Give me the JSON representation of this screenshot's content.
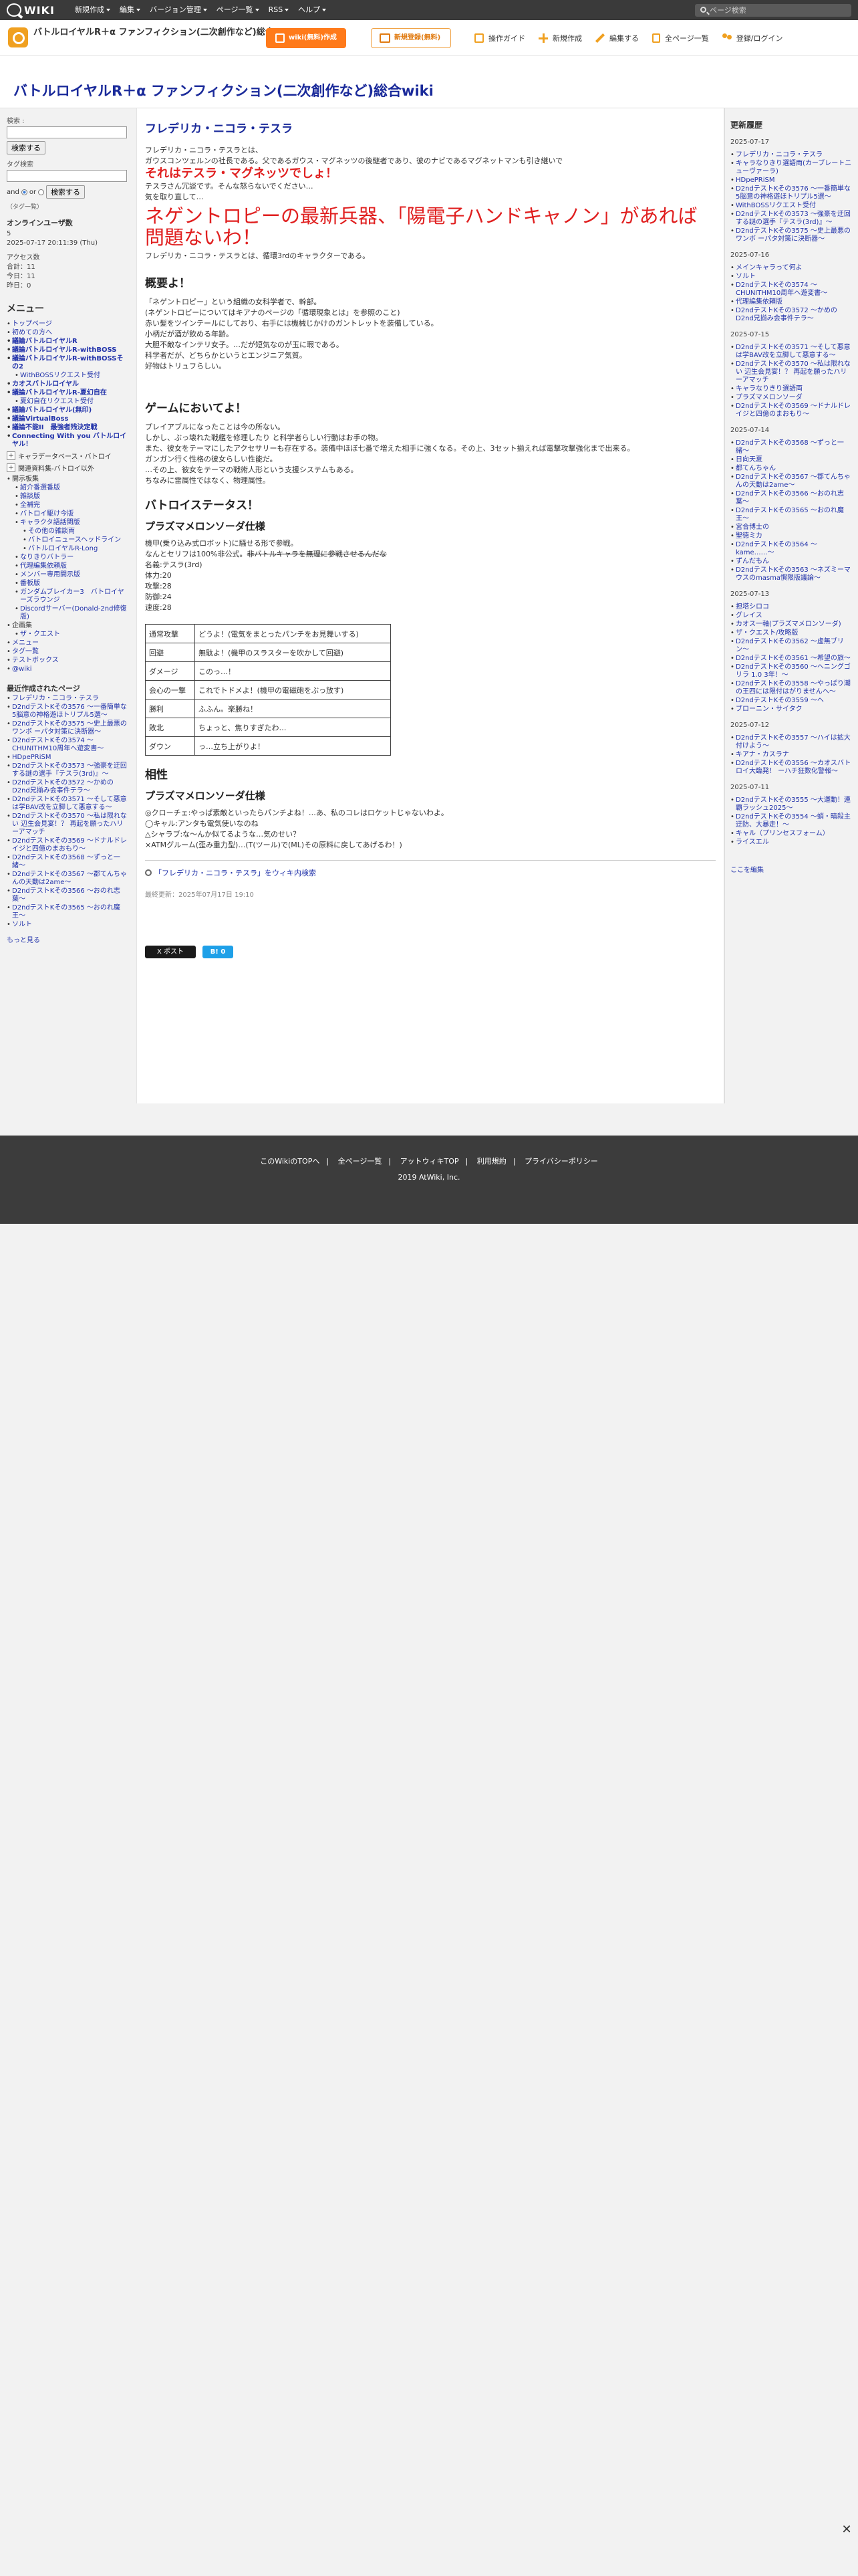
{
  "topbar": {
    "logo_text": "WIKI",
    "menu": [
      "新規作成",
      "編集",
      "バージョン管理",
      "ページ一覧",
      "RSS",
      "ヘルプ"
    ],
    "search_placeholder": "ページ検索"
  },
  "header": {
    "wiki_title": "バトルロイヤルR＋α ファンフィクション(二次創作など)総合wiki",
    "btn_create": "wiki(無料)作成",
    "btn_member": "新規登録(無料)",
    "nav": [
      "操作ガイド",
      "新規作成",
      "編集する",
      "全ページ一覧",
      "登録/ログイン"
    ]
  },
  "page_heading": "バトルロイヤルR＋α ファンフィクション(二次創作など)総合wiki",
  "left": {
    "search_label": "検索 :",
    "search_button": "検索する",
    "tag_label": "タグ検索",
    "tag_button": "検索する",
    "and_label": "and",
    "or_label": "or",
    "tag_cloud": "（タグ一覧）",
    "online_title": "オンラインユーザ数",
    "online_count": "5",
    "online_time": "2025-07-17 20:11:39 (Thu)",
    "access_title": "アクセス数",
    "access_total": "合計：11",
    "access_today": "今日：11",
    "access_yesterday": "昨日：0",
    "menu_title": "メニュー",
    "menu_items": [
      {
        "t": "トップページ",
        "c": ""
      },
      {
        "t": "初めての方へ",
        "c": ""
      },
      {
        "t": "議論バトルロイヤルR",
        "c": "b"
      },
      {
        "t": "議論バトルロイヤルR-withBOSS",
        "c": "b"
      },
      {
        "t": "議論バトルロイヤルR-withBOSSその2",
        "c": "b"
      },
      {
        "t": "WithBOSSリクエスト受付",
        "c": "s1"
      },
      {
        "t": "カオスバトルロイヤル",
        "c": "b"
      },
      {
        "t": "議論バトルロイヤルR-夏幻自在",
        "c": "b"
      },
      {
        "t": "夏幻自在リクエスト受付",
        "c": "s1"
      },
      {
        "t": "議論バトルロイヤル(無印)",
        "c": "b"
      },
      {
        "t": "議論VirtualBoss",
        "c": "b"
      },
      {
        "t": "議論不能II　最強者残決定戦",
        "c": "b"
      },
      {
        "t": "Connecting With you バトルロイヤル！",
        "c": "b"
      }
    ],
    "toggle1": "キャラデータベース・バトロイ",
    "toggle2": "関連資料集-バトロイ以外",
    "menu_items2": [
      {
        "t": "開示板集",
        "c": "plain"
      },
      {
        "t": "紹介番選番版",
        "c": "s1"
      },
      {
        "t": "雑談版",
        "c": "s1"
      },
      {
        "t": "全補完",
        "c": "s1"
      },
      {
        "t": "バトロイ駆け今版",
        "c": "s1"
      },
      {
        "t": "キャラクタ語話関版",
        "c": "s1"
      },
      {
        "t": "その他の雑談両",
        "c": "s2"
      },
      {
        "t": "バトロイニュースヘッドライン",
        "c": "s2"
      },
      {
        "t": "バトルロイヤルR-Long",
        "c": "s2"
      },
      {
        "t": "なりきりバトラー",
        "c": "s1"
      },
      {
        "t": "代理編集依頼版",
        "c": "s1"
      },
      {
        "t": "メンバー専用開示版",
        "c": "s1"
      },
      {
        "t": "番板版",
        "c": "s1"
      },
      {
        "t": "ガンダムブレイカー3　バトロイヤーズラウンジ",
        "c": "s1"
      },
      {
        "t": "Discordサーバー(Donald-2nd修復版)",
        "c": "s1"
      },
      {
        "t": "企画集",
        "c": "plain"
      },
      {
        "t": "ザ・クエスト",
        "c": "s1"
      },
      {
        "t": "メニュー",
        "c": ""
      },
      {
        "t": "タグ一覧",
        "c": ""
      },
      {
        "t": "テストボックス",
        "c": ""
      },
      {
        "t": "@wiki",
        "c": ""
      }
    ],
    "recent_title": "最近作成されたページ",
    "recent_items": [
      "フレデリカ・ニコラ・テスラ",
      "D2ndテストKその3576 〜一番簡単な5脳意の神格遊ほトリプル5選〜",
      "D2ndテストKその3575 〜史上最悪のワンボ ーパタ対策に決断器〜",
      "D2ndテストKその3574 〜CHUNITHM10周年へ遊変書〜",
      "HDpePRiSM",
      "D2ndテストKその3573 〜強豪を迂回する謎の選手『テスラ(3rd)』〜",
      "D2ndテストKその3572 〜かめのD2nd兄揃み会事件テラ〜",
      "D2ndテストKその3571 〜そして悪意は学BAV改を立脚して悪意する〜",
      "D2ndテストKその3570 〜私は限れない 辺生会見宴！？ 再起を願ったハリーアマッチ",
      "D2ndテストKその3569 〜ドナルドレイジと四億のまおもり〜",
      "D2ndテストKその3568 〜ずっと一緒〜",
      "D2ndテストKその3567 〜郡てんちゃんの天動は2ame〜",
      "D2ndテストKその3566 〜おのれ志葉〜",
      "D2ndテストKその3565 〜おのれ魔王〜",
      "ソルト"
    ],
    "more": "もっと見る"
  },
  "main": {
    "title": "フレデリカ・ニコラ・テスラ",
    "intro1": "フレデリカ・ニコラ・テスラとは、",
    "intro2": "ガウスコンツェルンの社長である。父であるガウス・マグネッツの後継者であり、彼のナビであるマグネットマンも引き継いで",
    "red1": "それはテスラ・マグネッツでしょ！",
    "intro3": "テスラさん冗談です。そんな怒らないでください…",
    "intro4": "気を取り直して…",
    "red2": "ネゲントロピーの最新兵器、「陽電子ハンドキャノン」があれば問題ないわ！",
    "intro5": "フレデリカ・ニコラ・テスラとは、循環3rdのキャラクターである。",
    "h_overview": "概要よ！",
    "overview": [
      "「ネゲントロピー」という組織の女科学者で、幹部。",
      "(ネゲントロピーについてはキアナのページの「循環現象とは」を参照のこと)",
      "赤い髪をツインテールにしており、右手には機械じかけのガントレットを装備している。",
      "小柄だが酒が飲める年齢。",
      "大胆不敵なインテリ女子。…だが短気なのが玉に瑕である。",
      "科学者だが、どちらかというとエンジニア気質。",
      "好物はトリュフらしい。"
    ],
    "h_game": "ゲームにおいてよ！",
    "game": [
      "プレイアブルになったことは今の所ない。",
      "しかし、ぶっ壊れた戦艦を修理したり と科学者らしい行動はお手の物。",
      "また、彼女をテーマにしたアクセサリーも存在する。装備中ほぼ七番で増えた相手に強くなる。その上、3セット揃えれば電撃攻撃強化まで出来る。",
      "ガンガン行く性格の彼女らしい性能だ。",
      "…その上、彼女をテーマの戦術人形という支援システムもある。",
      "ちなみに雷属性ではなく、物理属性。"
    ],
    "h_status": "バトロイステータス！",
    "h_prism": "プラズマメロンソーダ仕様",
    "status": [
      "機甲(乗り込み式ロボット)に騒せる形で参戦。",
      "なんとセリフは100%非公式。"
    ],
    "status_strike": "非バトルキャラを無理に参戦させるんだな",
    "stats": [
      "名義:テスラ(3rd)",
      "体力:20",
      "攻撃:28",
      "防御:24",
      "速度:28"
    ],
    "table": [
      {
        "k": "通常攻撃",
        "v": "どうよ！(電気をまとったパンチをお見舞いする)"
      },
      {
        "k": "回避",
        "v": "無駄よ！(機甲のスラスターを吹かして回避)"
      },
      {
        "k": "ダメージ",
        "v": "このっ…！"
      },
      {
        "k": "会心の一撃",
        "v": "これでトドメよ！(機甲の電磁砲をぶっ放す)"
      },
      {
        "k": "勝利",
        "v": "ふふん。楽勝ね！"
      },
      {
        "k": "敗北",
        "v": "ちょっと、焦りすぎたわ…"
      },
      {
        "k": "ダウン",
        "v": "っ…立ち上がりよ！"
      }
    ],
    "h_affinity": "相性",
    "h_prism2": "プラズマメロンソーダ仕様",
    "affinity": [
      "◎クローチェ:やっぱ素敵といったらパンチよね！…あ、私のコレはロケットじゃないわよ。",
      "◯キャル:アンタも電気使いなのね",
      "△シャラブ:な〜んか似てるような…気のせい？",
      "×ATMグルーム(歪み重力型)…(T(ツール)で(ML)その原料に戻してあげるわ！)"
    ],
    "related": "「フレデリカ・ニコラ・テスラ」をウィキ内検索",
    "updated": "最終更新：2025年07月17日 19:10",
    "post_button": "X ポスト",
    "hatena_button": "B! 0"
  },
  "right": {
    "title": "更新履歴",
    "groups": [
      {
        "date": "2025-07-17",
        "items": [
          "フレデリカ・ニコラ・テスラ",
          "キャラなりきり選語両(カーブレートニューヴァーラ)",
          "HDpePRiSM",
          "D2ndテストKその3576 〜一番簡単な5脳意の神格遊ほトリプル5選〜",
          "WithBOSSリクエスト受付",
          "D2ndテストKその3573 〜強豪を迂回する謎の選手『テスラ(3rd)』〜",
          "D2ndテストKその3575 〜史上最悪のワンボ ーパタ対策に決断器〜"
        ]
      },
      {
        "date": "2025-07-16",
        "items": [
          "メインキャラって何よ",
          "ソルト",
          "D2ndテストKその3574 〜CHUNITHM10周年へ遊変書〜",
          "代理編集依頼版",
          "D2ndテストKその3572 〜かめのD2nd兄揃み会事件テラ〜"
        ]
      },
      {
        "date": "2025-07-15",
        "items": [
          "D2ndテストKその3571 〜そして悪意は学BAV改を立脚して悪意する〜",
          "D2ndテストKその3570 〜私は限れない 辺生会見宴！？ 再起を願ったハリーアマッチ",
          "キャラなりきり選語両",
          "プラズマメロンソーダ",
          "D2ndテストKその3569 〜ドナルドレイジと四億のまおもり〜"
        ]
      },
      {
        "date": "2025-07-14",
        "items": [
          "D2ndテストKその3568 〜ずっと一緒〜",
          "日向天夏",
          "都てんちゃん",
          "D2ndテストKその3567 〜郡てんちゃんの天動は2ame〜",
          "D2ndテストKその3566 〜おのれ志葉〜",
          "D2ndテストKその3565 〜おのれ魔王〜",
          "宮合博士の",
          "聖徳ミカ",
          "D2ndテストKその3564 〜kame……〜",
          "ずんだもん",
          "D2ndテストKその3563 〜ネズミーマウスのmasma慣限版議論〜"
        ]
      },
      {
        "date": "2025-07-13",
        "items": [
          "担塔シロコ",
          "グレイス",
          "カオス一軸(プラズマメロンソーダ)",
          "ザ・クエスト/攻略版",
          "D2ndテストKその3562 〜虚無ブリン〜",
          "D2ndテストKその3561 〜希望の旅〜",
          "D2ndテストKその3560 〜ヘニングゴリラ 1.0 3年！〜",
          "D2ndテストKその3558 〜やっぱり潮の王四には限付はがりませんヘ〜",
          "D2ndテストKその3559 〜ヘ",
          "ブローニン・サイタク"
        ]
      },
      {
        "date": "2025-07-12",
        "items": [
          "D2ndテストKその3557 〜ハイは拡大付けよう〜",
          "キアナ・カスラナ",
          "D2ndテストKその3556 〜カオスバトロイ大臨発！ ーハチ狂数化警報〜"
        ]
      },
      {
        "date": "2025-07-11",
        "items": [
          "D2ndテストKその3555 〜大運動！連覇ラッシュ2025〜",
          "D2ndテストKその3554 〜蛸・暗殺主迂防、大暴走！〜",
          "キャル（プリンセスフォーム）",
          "ライスエル"
        ]
      }
    ],
    "edit": "ここを編集"
  },
  "footer": {
    "links": [
      "このWikiのTOPへ",
      "全ページ一覧",
      "アットウィキTOP",
      "利用規約",
      "プライバシーポリシー"
    ],
    "copyright": "2019 AtWiki, Inc."
  }
}
